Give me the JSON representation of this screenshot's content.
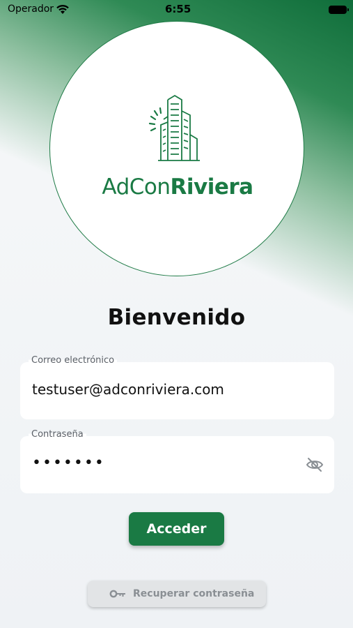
{
  "status_bar": {
    "carrier": "Operador",
    "time": "6:55"
  },
  "logo": {
    "brand_part1": "AdCon",
    "brand_part2": "Riviera",
    "color": "#1a7a44"
  },
  "welcome": "Bienvenido",
  "form": {
    "email": {
      "label": "Correo electrónico",
      "value": "testuser@adconriviera.com"
    },
    "password": {
      "label": "Contraseña",
      "value": "•••••••",
      "toggle_icon": "eye-off-icon"
    },
    "submit_label": "Acceder",
    "recover_label": "Recuperar contraseña",
    "recover_icon": "key-icon"
  },
  "colors": {
    "primary": "#1a7a44",
    "background": "#eff2f5"
  }
}
